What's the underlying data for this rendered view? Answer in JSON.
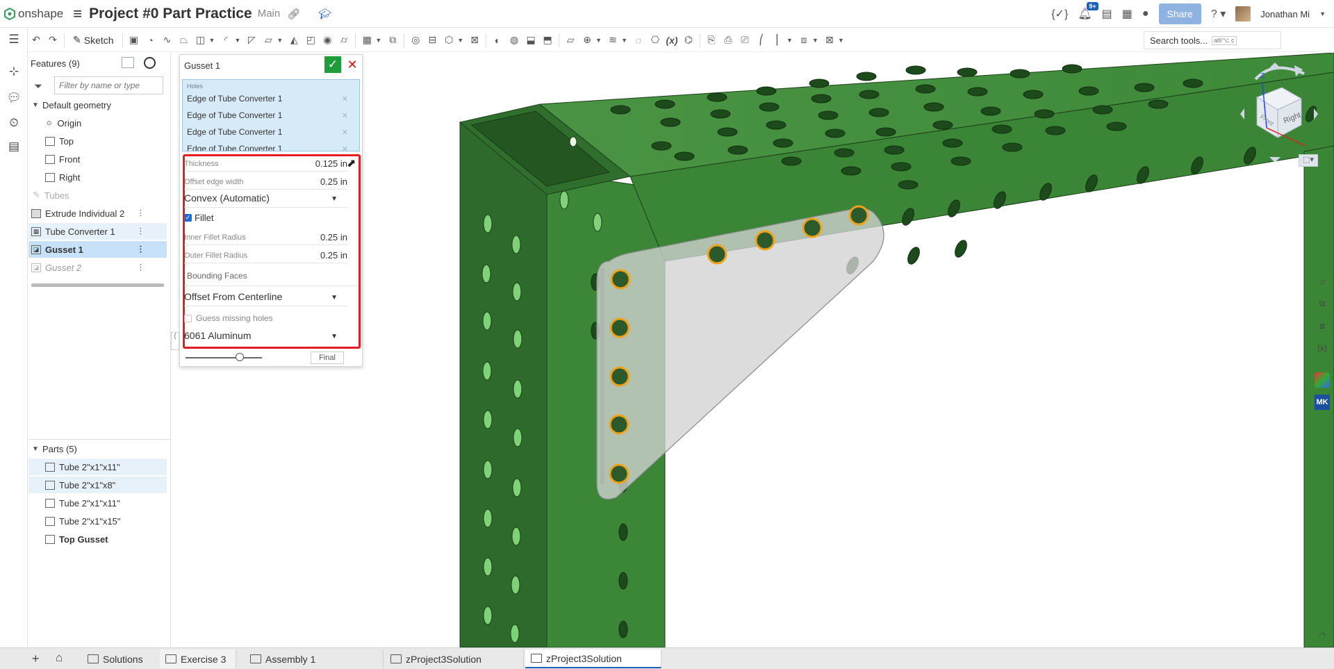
{
  "app": {
    "brand": "onshape",
    "doc_title": "Project #0 Part Practice",
    "branch": "Main",
    "notifications": "9+",
    "share_label": "Share",
    "user_name": "Jonathan Mi"
  },
  "toolbar": {
    "sketch_label": "Sketch",
    "search_label": "Search tools...",
    "search_shortcut": "alt/⌥ c"
  },
  "feature_tree": {
    "header": "Features (9)",
    "filter_placeholder": "Filter by name or type",
    "default_geometry": "Default geometry",
    "items": [
      {
        "label": "Origin"
      },
      {
        "label": "Top"
      },
      {
        "label": "Front"
      },
      {
        "label": "Right"
      },
      {
        "label": "Tubes"
      },
      {
        "label": "Extrude Individual 2"
      },
      {
        "label": "Tube Converter 1"
      },
      {
        "label": "Gusset 1"
      },
      {
        "label": "Gusset 2"
      }
    ],
    "parts_header": "Parts (5)",
    "parts": [
      {
        "label": "Tube 2\"x1\"x11\""
      },
      {
        "label": "Tube 2\"x1\"x8\""
      },
      {
        "label": "Tube 2\"x1\"x11\""
      },
      {
        "label": "Tube 2\"x1\"x15\""
      },
      {
        "label": "Top Gusset"
      }
    ]
  },
  "gusset_dialog": {
    "title": "Gusset 1",
    "holes_label": "Holes",
    "holes": [
      "Edge of Tube Converter 1",
      "Edge of Tube Converter 1",
      "Edge of Tube Converter 1",
      "Edge of Tube Converter 1"
    ],
    "thickness_label": "Thickness",
    "thickness_value": "0.125 in",
    "offset_label": "Offset edge width",
    "offset_value": "0.25 in",
    "shape_value": "Convex (Automatic)",
    "fillet_label": "Fillet",
    "fillet_checked": true,
    "inner_fillet_label": "Inner Fillet Radius",
    "inner_fillet_value": "0.25 in",
    "outer_fillet_label": "Outer Fillet Radius",
    "outer_fillet_value": "0.25 in",
    "bounding_label": "Bounding Faces",
    "bounding_value": "Offset From Centerline",
    "guess_label": "Guess missing holes",
    "guess_checked": false,
    "material_value": "6061 Aluminum",
    "final_label": "Final"
  },
  "view_cube": {
    "face_right": "Right",
    "face_front": "Front",
    "axis_z": "Z"
  },
  "bottom_tabs": [
    {
      "label": "Solutions"
    },
    {
      "label": "Exercise 3"
    },
    {
      "label": "Assembly 1"
    },
    {
      "label": "zProject3Solution"
    },
    {
      "label": "zProject3Solution"
    }
  ],
  "colors": {
    "tube_green": "#3f8a3a",
    "tube_dark": "#2a6328",
    "accent_blue": "#1c5fb8",
    "highlight_red": "#e31e26",
    "hole_ring": "#f0a21a"
  }
}
